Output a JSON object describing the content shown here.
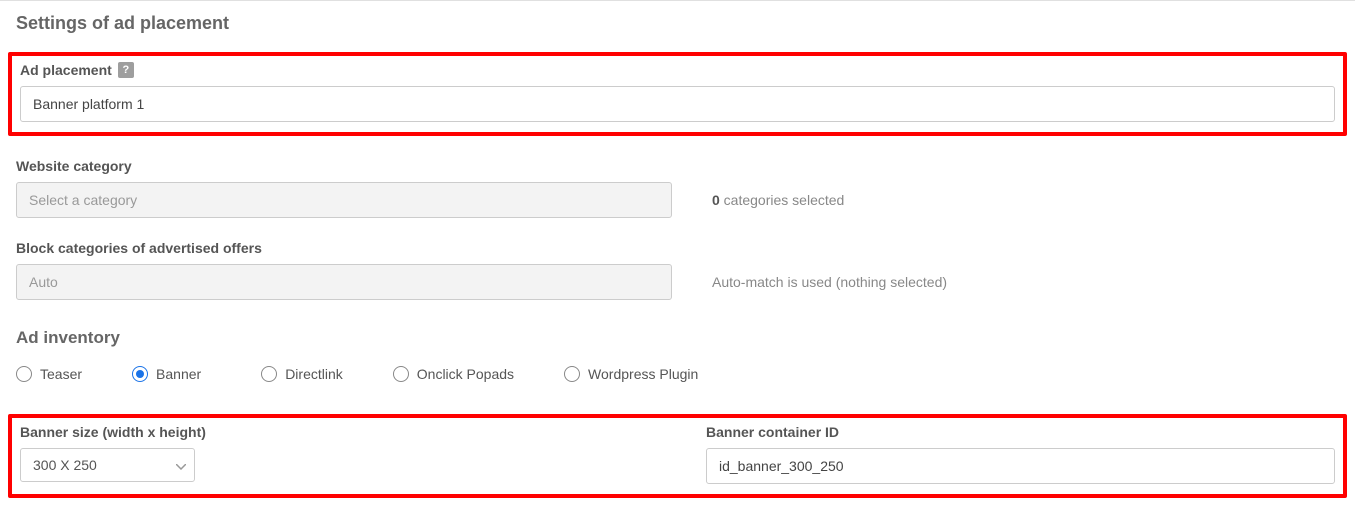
{
  "section_title": "Settings of ad placement",
  "ad_placement": {
    "label": "Ad placement",
    "value": "Banner platform 1"
  },
  "website_category": {
    "label": "Website category",
    "placeholder": "Select a category",
    "count": "0",
    "count_suffix": " categories selected"
  },
  "block_categories": {
    "label": "Block categories of advertised offers",
    "placeholder": "Auto",
    "hint": "Auto-match is used (nothing selected)"
  },
  "ad_inventory": {
    "heading": "Ad inventory",
    "options": {
      "teaser": "Teaser",
      "banner": "Banner",
      "directlink": "Directlink",
      "onclick": "Onclick Popads",
      "wordpress": "Wordpress Plugin"
    },
    "selected": "banner"
  },
  "banner_size": {
    "label": "Banner size (width x height)",
    "value": "300 X 250"
  },
  "banner_container": {
    "label": "Banner container ID",
    "value": "id_banner_300_250"
  }
}
